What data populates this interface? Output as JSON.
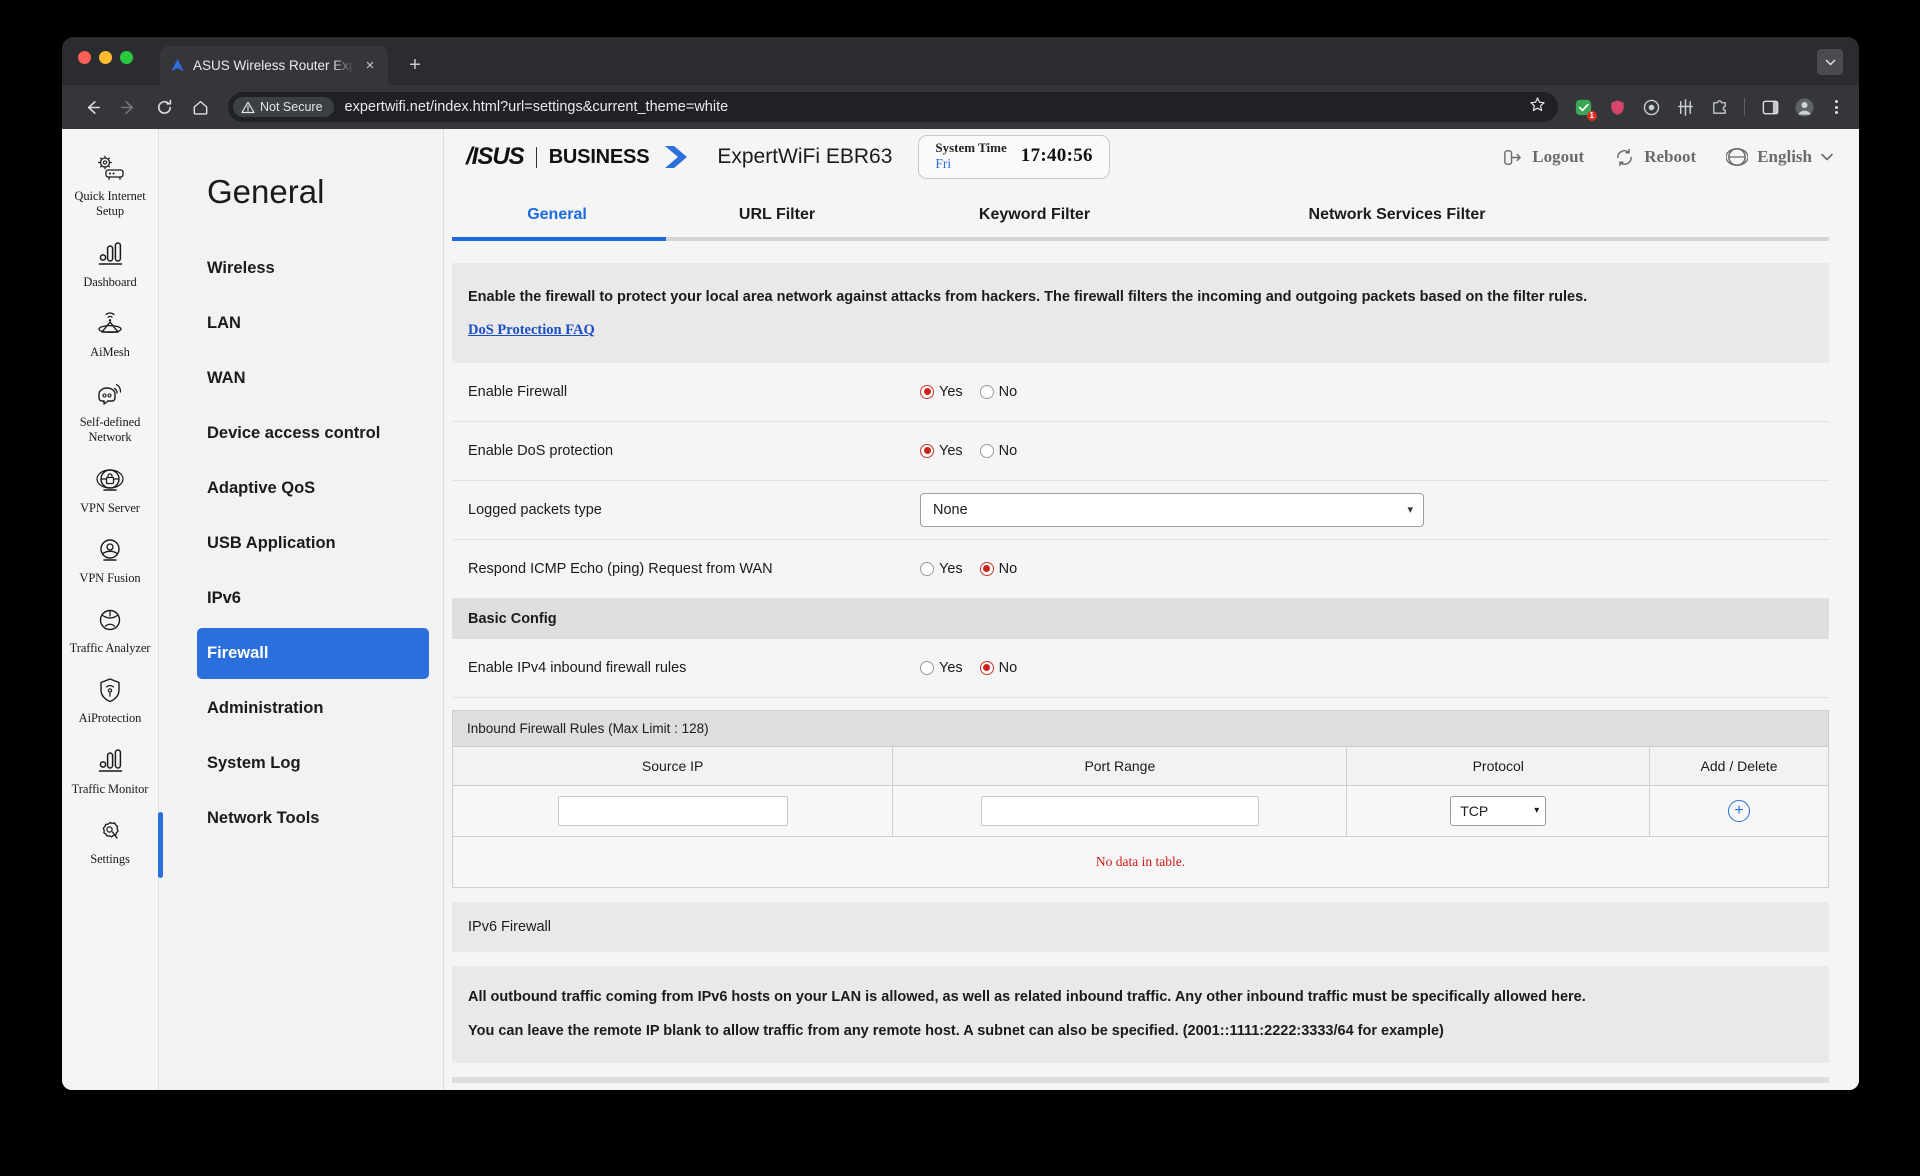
{
  "browser": {
    "tab": {
      "title": "ASUS Wireless Router Exper",
      "favicon": "asus-router-icon",
      "close": "×"
    },
    "new_tab": "+",
    "window_menu": "⌄",
    "toolbar": {
      "back": "←",
      "forward": "→",
      "reload": "↻",
      "home": "⌂",
      "security_label": "Not Secure",
      "url": "expertwifi.net/index.html?url=settings&current_theme=white",
      "bookmark": "star-icon",
      "extension_badge": "1",
      "menu": "⋮"
    }
  },
  "header": {
    "brand": "/ISUS",
    "brand_secondary": "BUSINESS",
    "model": "ExpertWiFi EBR63",
    "system_time_label": "System Time",
    "system_time_day": "Fri",
    "system_time_clock": "17:40:56",
    "logout": "Logout",
    "reboot": "Reboot",
    "language": "English"
  },
  "rail": {
    "items": [
      {
        "label": "Quick Internet Setup",
        "icon": "quick-setup-icon",
        "active": false
      },
      {
        "label": "Dashboard",
        "icon": "dashboard-icon",
        "active": false
      },
      {
        "label": "AiMesh",
        "icon": "aimesh-icon",
        "active": false
      },
      {
        "label": "Self-defined Network",
        "icon": "self-defined-network-icon",
        "active": false
      },
      {
        "label": "VPN Server",
        "icon": "vpn-server-icon",
        "active": false
      },
      {
        "label": "VPN Fusion",
        "icon": "vpn-fusion-icon",
        "active": false
      },
      {
        "label": "Traffic Analyzer",
        "icon": "traffic-analyzer-icon",
        "active": false
      },
      {
        "label": "AiProtection",
        "icon": "aiprotection-icon",
        "active": false
      },
      {
        "label": "Traffic Monitor",
        "icon": "traffic-monitor-icon",
        "active": false
      },
      {
        "label": "Settings",
        "icon": "settings-gear-icon",
        "active": true
      }
    ]
  },
  "subnav": {
    "title": "General",
    "items": [
      {
        "label": "Wireless",
        "active": false
      },
      {
        "label": "LAN",
        "active": false
      },
      {
        "label": "WAN",
        "active": false
      },
      {
        "label": "Device access control",
        "active": false
      },
      {
        "label": "Adaptive QoS",
        "active": false
      },
      {
        "label": "USB Application",
        "active": false
      },
      {
        "label": "IPv6",
        "active": false
      },
      {
        "label": "Firewall",
        "active": true
      },
      {
        "label": "Administration",
        "active": false
      },
      {
        "label": "System Log",
        "active": false
      },
      {
        "label": "Network Tools",
        "active": false
      }
    ]
  },
  "tabs": [
    {
      "label": "General",
      "active": true
    },
    {
      "label": "URL Filter",
      "active": false
    },
    {
      "label": "Keyword Filter",
      "active": false
    },
    {
      "label": "Network Services Filter",
      "active": false
    }
  ],
  "content": {
    "intro_text": "Enable the firewall to protect your local area network against attacks from hackers. The firewall filters the incoming and outgoing packets based on the filter rules.",
    "faq_link": "DoS Protection FAQ",
    "rows": [
      {
        "label": "Enable Firewall",
        "type": "radio",
        "yes": "Yes",
        "no": "No",
        "value": "Yes"
      },
      {
        "label": "Enable DoS protection",
        "type": "radio",
        "yes": "Yes",
        "no": "No",
        "value": "Yes"
      },
      {
        "label": "Logged packets type",
        "type": "select",
        "value": "None"
      },
      {
        "label": "Respond ICMP Echo (ping) Request from WAN",
        "type": "radio",
        "yes": "Yes",
        "no": "No",
        "value": "No"
      }
    ],
    "basic_config_title": "Basic Config",
    "ipv4_row": {
      "label": "Enable IPv4 inbound firewall rules",
      "yes": "Yes",
      "no": "No",
      "value": "No"
    },
    "rules_table": {
      "title": "Inbound Firewall Rules (Max Limit : 128)",
      "columns": [
        "Source IP",
        "Port Range",
        "Protocol",
        "Add / Delete"
      ],
      "input_row": {
        "source_ip": "",
        "port_range": "",
        "protocol": "TCP",
        "add_button": "+"
      },
      "empty_message": "No data in table."
    },
    "ipv6_section_title": "IPv6 Firewall",
    "ipv6_notes": [
      "All outbound traffic coming from IPv6 hosts on your LAN is allowed, as well as related inbound traffic. Any other inbound traffic must be specifically allowed here.",
      "You can leave the remote IP blank to allow traffic from any remote host. A subnet can also be specified. (2001::1111:2222:3333/64 for example)"
    ]
  },
  "colors": {
    "accent": "#2a6fdb",
    "tab_active": "#1a6ae0",
    "radio_selected": "#d0211c",
    "error_text": "#d11b1b",
    "link": "#1a4fc4"
  }
}
